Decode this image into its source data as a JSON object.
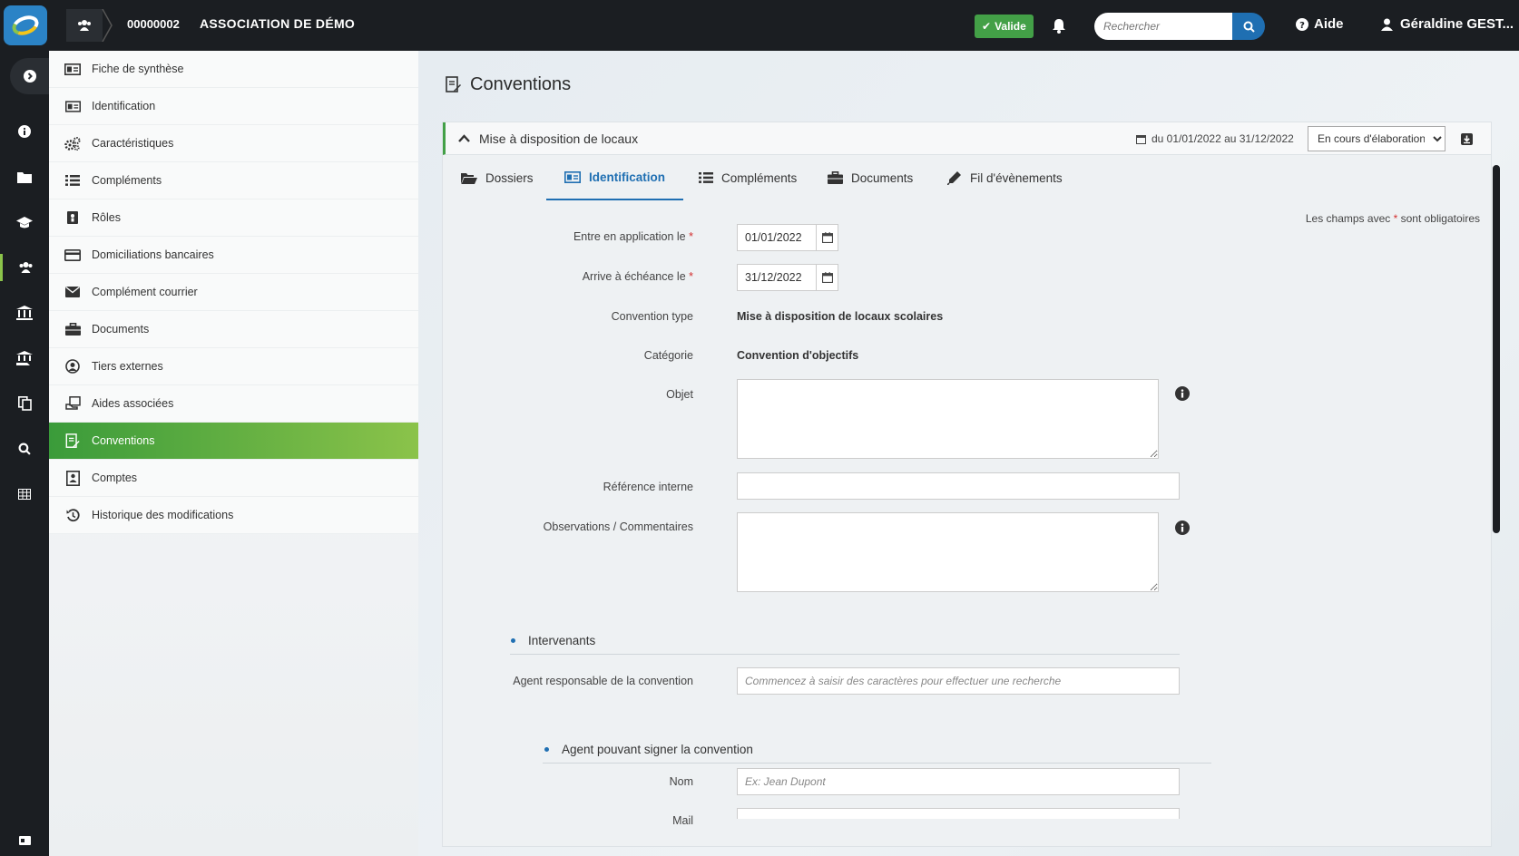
{
  "topbar": {
    "record_id": "00000002",
    "org_name": "ASSOCIATION DE DÉMO",
    "status_badge": "Valide",
    "search_placeholder": "Rechercher",
    "help_label": "Aide",
    "user_name": "Géraldine GEST..."
  },
  "rail": {
    "icons": [
      "info-icon",
      "folder-icon",
      "graduation-cap-icon",
      "users-icon",
      "institution-icon",
      "institution-hand-icon",
      "copy-icon",
      "search-icon",
      "table-icon",
      "id-card-icon"
    ]
  },
  "subnav": {
    "items": [
      {
        "label": "Fiche de synthèse",
        "icon": "id-card-icon"
      },
      {
        "label": "Identification",
        "icon": "address-card-icon"
      },
      {
        "label": "Caractéristiques",
        "icon": "cogs-icon"
      },
      {
        "label": "Compléments",
        "icon": "list-icon"
      },
      {
        "label": "Rôles",
        "icon": "user-badge-icon"
      },
      {
        "label": "Domiciliations bancaires",
        "icon": "credit-card-icon"
      },
      {
        "label": "Complément courrier",
        "icon": "envelope-icon"
      },
      {
        "label": "Documents",
        "icon": "briefcase-icon"
      },
      {
        "label": "Tiers externes",
        "icon": "user-circle-icon"
      },
      {
        "label": "Aides associées",
        "icon": "aid-icon"
      },
      {
        "label": "Conventions",
        "icon": "convention-icon"
      },
      {
        "label": "Comptes",
        "icon": "account-icon"
      },
      {
        "label": "Historique des modifications",
        "icon": "history-icon"
      }
    ],
    "active_index": 10
  },
  "main": {
    "page_title": "Conventions",
    "panel": {
      "title": "Mise à disposition de locaux",
      "period": "du 01/01/2022 au 31/12/2022",
      "status_select": "En cours d'élaboration"
    },
    "tabs": [
      {
        "label": "Dossiers",
        "icon": "folder-open-icon"
      },
      {
        "label": "Identification",
        "icon": "address-card-icon"
      },
      {
        "label": "Compléments",
        "icon": "list-icon"
      },
      {
        "label": "Documents",
        "icon": "briefcase-icon"
      },
      {
        "label": "Fil d'évènements",
        "icon": "pencil-icon"
      }
    ],
    "active_tab": 1,
    "required_note_prefix": "Les champs avec",
    "required_note_suffix": "sont obligatoires",
    "required_mark": "*",
    "form": {
      "start_label": "Entre en application le",
      "start_value": "01/01/2022",
      "end_label": "Arrive à échéance le",
      "end_value": "31/12/2022",
      "type_label": "Convention type",
      "type_value": "Mise à disposition de locaux scolaires",
      "category_label": "Catégorie",
      "category_value": "Convention d'objectifs",
      "object_label": "Objet",
      "object_value": "",
      "ref_label": "Référence interne",
      "ref_value": "",
      "obs_label": "Observations / Commentaires",
      "obs_value": ""
    },
    "intervenants": {
      "section_title": "Intervenants",
      "agent_label": "Agent responsable de la convention",
      "agent_placeholder": "Commencez à saisir des caractères pour effectuer une recherche"
    },
    "signataire": {
      "section_title": "Agent pouvant signer la convention",
      "name_label": "Nom",
      "name_placeholder": "Ex: Jean Dupont",
      "mail_label": "Mail"
    }
  }
}
